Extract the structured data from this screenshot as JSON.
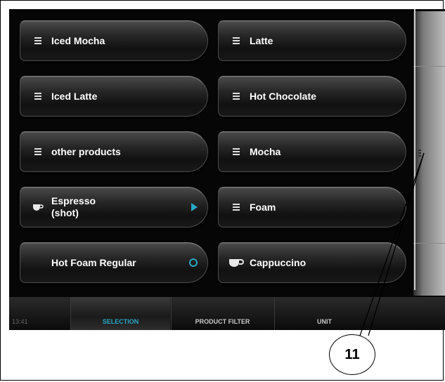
{
  "products": [
    {
      "label": "Iced Mocha",
      "icon": "menu-icon"
    },
    {
      "label": "Latte",
      "icon": "menu-icon"
    },
    {
      "label": "Iced Latte",
      "icon": "menu-icon"
    },
    {
      "label": "Hot Chocolate",
      "icon": "menu-icon"
    },
    {
      "label": "other products",
      "icon": "menu-icon"
    },
    {
      "label": "Mocha",
      "icon": "menu-icon"
    },
    {
      "label": "Espresso\n(shot)",
      "icon": "cup-icon",
      "indicator": "play-icon"
    },
    {
      "label": "Foam",
      "icon": "menu-icon"
    },
    {
      "label": "Hot Foam Regular",
      "icon": "none",
      "indicator": "ring-icon"
    },
    {
      "label": "Cappuccino",
      "icon": "cup-icon"
    }
  ],
  "status": {
    "time": "13:41"
  },
  "tabs": [
    {
      "label": "SELECTION",
      "active": true
    },
    {
      "label": "PRODUCT FILTER",
      "active": false
    },
    {
      "label": "UNIT",
      "active": false
    }
  ],
  "callout": {
    "number": "11"
  },
  "colors": {
    "accent": "#2aa6c4",
    "background": "#060606",
    "text": "#ffffff"
  }
}
